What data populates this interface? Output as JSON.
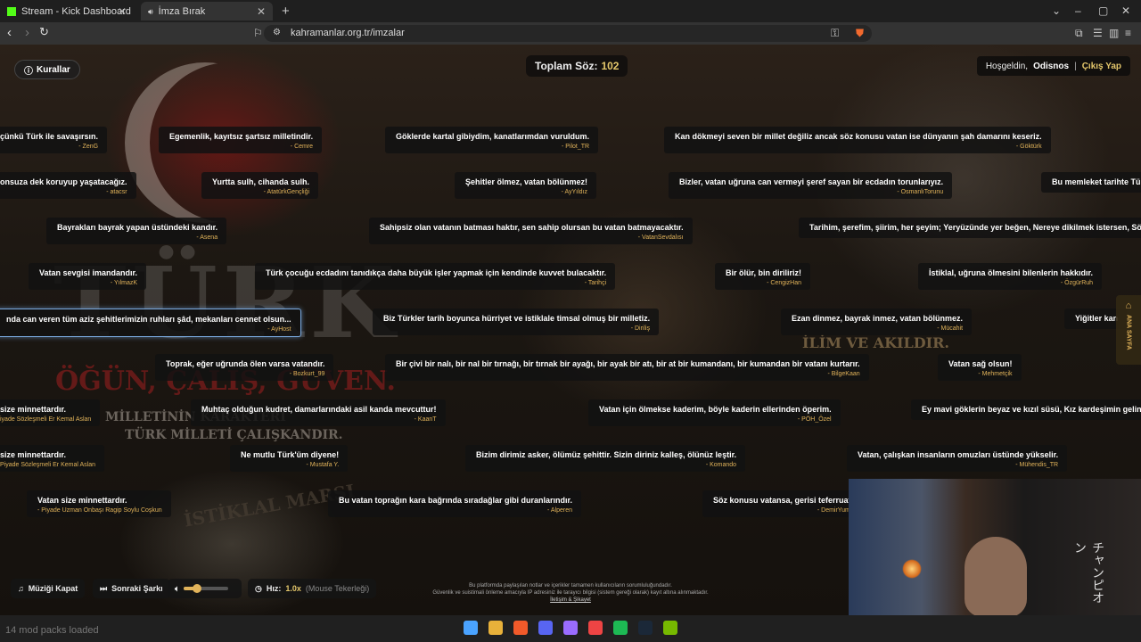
{
  "browser": {
    "tabs": [
      {
        "label": "Stream - Kick Dashboard"
      },
      {
        "label": "İmza Bırak"
      }
    ],
    "url": "kahramanlar.org.tr/imzalar"
  },
  "page": {
    "rules_label": "Kurallar",
    "counter_label": "Toplam Söz:",
    "counter_value": "102",
    "welcome": "Hoşgeldin,",
    "username": "Odisnos",
    "separator": "|",
    "logout": "Çıkış Yap",
    "side_tab": "ANA SAYFA",
    "background_text": {
      "turk": "TÜRK",
      "ogun": "ÖĞÜN, ÇALIŞ, GÜVEN.",
      "motto1": "MİLLETİNİN KARAKTERİ",
      "motto2": "TÜRK MİLLETİ ÇALIŞKANDIR.",
      "istiklal": "İSTİKLAL MARŞI",
      "ilim": "İLİM VE AKILDIR."
    },
    "signatures": [
      {
        "quote": "çünkü Türk ile savaşırsın.",
        "author": "- ZenG"
      },
      {
        "quote": "Egemenlik, kayıtsız şartsız milletindir.",
        "author": "- Cemre"
      },
      {
        "quote": "Göklerde kartal gibiydim, kanatlarımdan vuruldum.",
        "author": "- Pilot_TR"
      },
      {
        "quote": "Kan dökmeyi seven bir millet değiliz ancak söz konusu vatan ise dünyanın şah damarını keseriz.",
        "author": "- Göktürk"
      },
      {
        "quote": "onsuza dek koruyup yaşatacağız.",
        "author": "- atacsr"
      },
      {
        "quote": "Yurtta sulh, cihanda sulh.",
        "author": "- AtatürkGençliği"
      },
      {
        "quote": "Şehitler ölmez, vatan bölünmez!",
        "author": "- AyYıldız"
      },
      {
        "quote": "Bizler, vatan uğruna can vermeyi şeref sayan bir ecdadın torunlarıyız.",
        "author": "- OsmanlıTorunu"
      },
      {
        "quote": "Bu memleket tarihte Türk",
        "author": ""
      },
      {
        "quote": "Bayrakları bayrak yapan üstündeki kandır.",
        "author": "- Asena"
      },
      {
        "quote": "Sahipsiz olan vatanın batması haktır, sen sahip olursan bu vatan batmayacaktır.",
        "author": "- VatanSevdalısı"
      },
      {
        "quote": "Tarihim, şerefim, şiirim, her şeyim; Yeryüzünde yer beğen, Nereye dikilmek istersen, Söyle,",
        "author": ""
      },
      {
        "quote": "Vatan sevgisi imandandır.",
        "author": "- YılmazK"
      },
      {
        "quote": "Türk çocuğu ecdadını tanıdıkça daha büyük işler yapmak için kendinde kuvvet bulacaktır.",
        "author": "- Tarihçi"
      },
      {
        "quote": "Bir ölür, bin diriliriz!",
        "author": "- CengizHan"
      },
      {
        "quote": "İstiklal, uğruna ölmesini bilenlerin hakkıdır.",
        "author": "- ÖzgürRuh"
      },
      {
        "quote": "nda can veren tüm aziz şehitlerimizin ruhları şâd, mekanları cennet olsun...",
        "author": "- AyHost"
      },
      {
        "quote": "Biz Türkler tarih boyunca hürriyet ve istiklale timsal olmuş bir milletiz.",
        "author": "- Diriliş"
      },
      {
        "quote": "Ezan dinmez, bayrak inmez, vatan bölünmez.",
        "author": "- Mücahit"
      },
      {
        "quote": "Yiğitler kan",
        "author": ""
      },
      {
        "quote": "Toprak, eğer uğrunda ölen varsa vatandır.",
        "author": "- Bozkurt_99"
      },
      {
        "quote": "Bir çivi bir nalı, bir nal bir tırnağı, bir tırnak bir ayağı, bir ayak bir atı, bir at bir kumandanı, bir kumandan bir vatanı kurtarır.",
        "author": "- BilgeKaan"
      },
      {
        "quote": "Vatan sağ olsun!",
        "author": "- Mehmetçik"
      },
      {
        "quote": "size minnettardır.",
        "author": "iyade Sözleşmeli Er Kemal Aslan"
      },
      {
        "quote": "Muhtaç olduğun kudret, damarlarındaki asil kanda mevcuttur!",
        "author": "- KaanT"
      },
      {
        "quote": "Vatan için ölmekse kaderim, böyle kaderin ellerinden öperim.",
        "author": "- PÖH_Özel"
      },
      {
        "quote": "Ey mavi göklerin beyaz ve kızıl süsü, Kız kardeşimin gelinliği,",
        "author": ""
      },
      {
        "quote": "size minnettardır.",
        "author": "Piyade Sözleşmeli Er Kemal Aslan"
      },
      {
        "quote": "Ne mutlu Türk'üm diyene!",
        "author": "- Mustafa Y."
      },
      {
        "quote": "Bizim dirimiz asker, ölümüz şehittir. Sizin diriniz kalleş, ölünüz leştir.",
        "author": "- Komando"
      },
      {
        "quote": "Vatan, çalışkan insanların omuzları üstünde yükselir.",
        "author": "- Mühendis_TR"
      },
      {
        "quote": "Vatan size minnettardır.",
        "author": "- Piyade Uzman Onbaşı Ragip Soylu Coşkun"
      },
      {
        "quote": "Bu vatan toprağın kara bağrında sıradağlar gibi duranlarındır.",
        "author": "- Alperen"
      },
      {
        "quote": "Söz konusu vatansa, gerisi teferruattı",
        "author": "- DemirYumru"
      }
    ],
    "controls": {
      "music": "Müziği Kapat",
      "next": "Sonraki Şarkı",
      "volume_percent": 30,
      "speed_label": "Hız:",
      "speed_value": "1.0x",
      "speed_hint": "(Mouse Tekerleği)"
    },
    "footer": {
      "line1": "Bu platformda paylaşılan notlar ve içerikler tamamen kullanıcıların sorumluluğundadır.",
      "line2": "Güvenlik ve suistimali önleme amacıyla IP adresiniz ile tarayıcı bilgisi (sistem gereği olarak) kayıt altına alınmaktadır.",
      "link": "İletişim & Şikayet"
    },
    "stream_overlay_text": "チャンピオン"
  },
  "taskbar": {
    "status": "14 mod packs loaded",
    "icons": [
      "windows-icon",
      "folder-icon",
      "brave-icon",
      "discord-icon",
      "obs-icon",
      "chrome-icon",
      "spotify-icon",
      "steam-icon",
      "nvidia-icon"
    ],
    "colors": {
      "accent": "#e1b35a",
      "highlight": "#e4c76b"
    }
  }
}
